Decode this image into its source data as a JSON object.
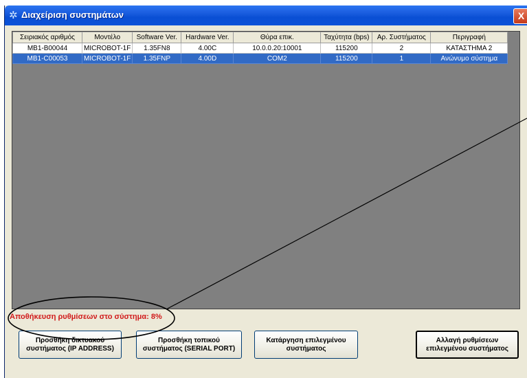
{
  "window": {
    "title": "Διαχείριση συστημάτων",
    "close_label": "X",
    "icon": "gear-icon"
  },
  "table": {
    "columns": [
      "Σειριακός αριθμός",
      "Μοντέλο",
      "Software Ver.",
      "Hardware Ver.",
      "Θύρα επικ.",
      "Ταχύτητα (bps)",
      "Αρ. Συστήματος",
      "Περιγραφή"
    ],
    "rows": [
      [
        "MB1-B00044",
        "MICROBOT-1F",
        "1.35FN8",
        "4.00C",
        "10.0.0.20:10001",
        "115200",
        "2",
        "ΚΑΤΑΣΤΗΜΑ 2"
      ],
      [
        "MB1-C00053",
        "MICROBOT-1F",
        "1.35FNP",
        "4.00D",
        "COM2",
        "115200",
        "1",
        "Ανώνυμο σύστημα"
      ]
    ],
    "selected_row": 1
  },
  "status": {
    "text": "Αποθήκευση ρυθμίσεων στο σύστημα: 8%",
    "color": "#d11a1a"
  },
  "buttons": {
    "add_network": "Προσθήκη δικτυακού\nσυστήματος (IP ADDRESS)",
    "add_local": "Προσθήκη τοπικού\nσυστήματος (SERIAL PORT)",
    "remove_selected": "Κατάργηση επιλεγμένου\nσυστήματος",
    "change_settings": "Αλλαγή ρυθμίσεων\nεπιλεγμένου συστήματος"
  },
  "colors": {
    "title_bar": "#0a4fd4",
    "selection": "#316ac5",
    "grid_background": "#808080"
  }
}
